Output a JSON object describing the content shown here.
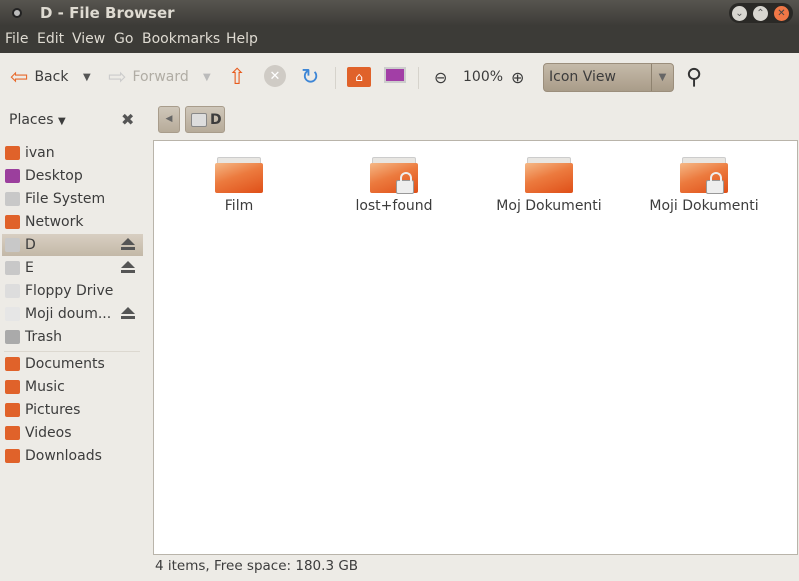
{
  "window": {
    "title": "D - File Browser"
  },
  "menu": [
    "File",
    "Edit",
    "View",
    "Go",
    "Bookmarks",
    "Help"
  ],
  "toolbar": {
    "back": "Back",
    "forward": "Forward",
    "zoom": "100%",
    "view_mode": "Icon View"
  },
  "location": {
    "places_label": "Places",
    "current": "D"
  },
  "sidebar": [
    {
      "label": "ivan",
      "color": "#e0622a"
    },
    {
      "label": "Desktop",
      "color": "#9b3f9d"
    },
    {
      "label": "File System",
      "color": "#c8c8c8"
    },
    {
      "label": "Network",
      "color": "#e0622a"
    },
    {
      "label": "D",
      "color": "#c8c8c8",
      "eject": true,
      "selected": true
    },
    {
      "label": "E",
      "color": "#c8c8c8",
      "eject": true
    },
    {
      "label": "Floppy Drive",
      "color": "#dddddd"
    },
    {
      "label": "Moji doum...",
      "color": "#e6e6e6",
      "eject": true
    },
    {
      "label": "Trash",
      "color": "#aaaaaa"
    },
    {
      "label": "Documents",
      "color": "#e0622a"
    },
    {
      "label": "Music",
      "color": "#e0622a"
    },
    {
      "label": "Pictures",
      "color": "#e0622a"
    },
    {
      "label": "Videos",
      "color": "#e0622a"
    },
    {
      "label": "Downloads",
      "color": "#e0622a"
    }
  ],
  "files": [
    {
      "name": "Film",
      "locked": false
    },
    {
      "name": "lost+found",
      "locked": true
    },
    {
      "name": "Moj Dokumenti",
      "locked": false
    },
    {
      "name": "Moji Dokumenti",
      "locked": true
    }
  ],
  "status": "4 items, Free space: 180.3 GB"
}
